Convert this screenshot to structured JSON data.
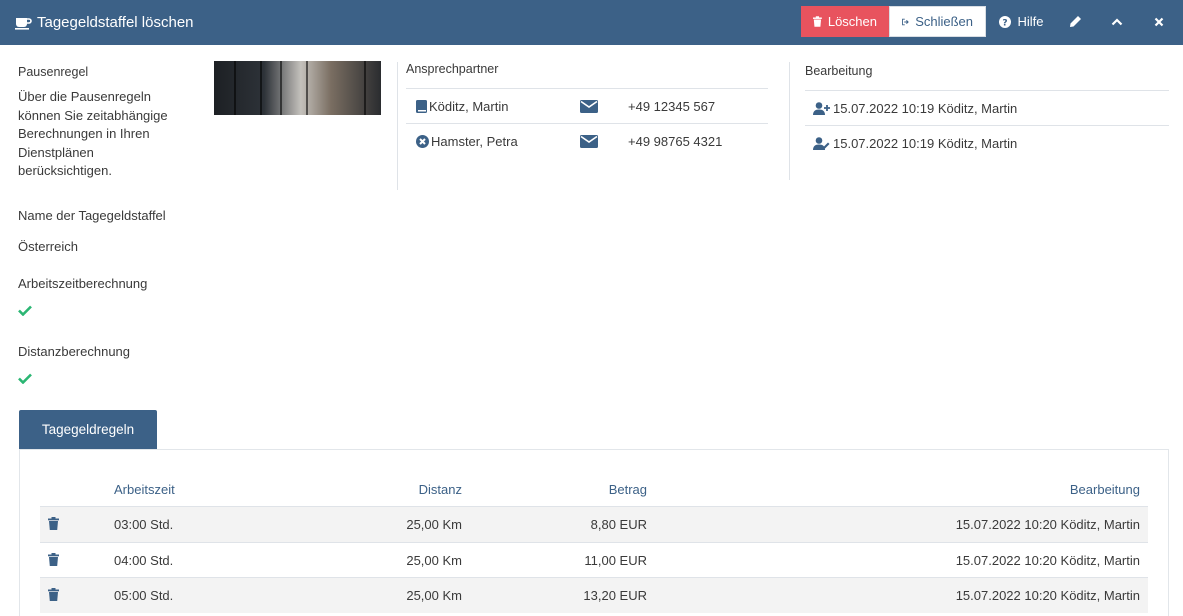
{
  "window": {
    "title": "Tagegeldstaffel löschen"
  },
  "toolbar": {
    "delete_label": "Löschen",
    "close_label": "Schließen",
    "help_label": "Hilfe"
  },
  "colors": {
    "header": "#3c6187",
    "danger": "#e8535e",
    "success": "#2bb673",
    "icon": "#3c6187"
  },
  "intro": {
    "title": "Pausenregel",
    "text": "Über die Pausenregeln können Sie zeitabhängige Berechnungen in Ihren Dienstplänen berücksichtigen."
  },
  "contacts": {
    "title": "Ansprechpartner",
    "items": [
      {
        "name": "Köditz, Martin",
        "phone": "+49 12345 567",
        "icon": "book-icon"
      },
      {
        "name": "Hamster, Petra",
        "phone": "+49 98765 4321",
        "icon": "times-circle-icon"
      }
    ]
  },
  "edits": {
    "title": "Bearbeitung",
    "items": [
      {
        "text": "15.07.2022 10:19 Köditz, Martin",
        "icon": "user-plus-icon"
      },
      {
        "text": "15.07.2022 10:19 Köditz, Martin",
        "icon": "user-edit-icon"
      }
    ]
  },
  "fields": {
    "name_label": "Name der Tagegeldstaffel",
    "name_value": "Österreich",
    "work_label": "Arbeitszeitberechnung",
    "work_value": true,
    "distance_label": "Distanzberechnung",
    "distance_value": true
  },
  "tabs": [
    {
      "label": "Tagegeldregeln",
      "active": true
    }
  ],
  "table": {
    "headers": {
      "time": "Arbeitszeit",
      "distance": "Distanz",
      "amount": "Betrag",
      "edit": "Bearbeitung"
    },
    "rows": [
      {
        "time": "03:00 Std.",
        "distance": "25,00 Km",
        "amount": "8,80 EUR",
        "edit": "15.07.2022 10:20 Köditz, Martin"
      },
      {
        "time": "04:00 Std.",
        "distance": "25,00 Km",
        "amount": "11,00 EUR",
        "edit": "15.07.2022 10:20 Köditz, Martin"
      },
      {
        "time": "05:00 Std.",
        "distance": "25,00 Km",
        "amount": "13,20 EUR",
        "edit": "15.07.2022 10:20 Köditz, Martin"
      }
    ]
  }
}
